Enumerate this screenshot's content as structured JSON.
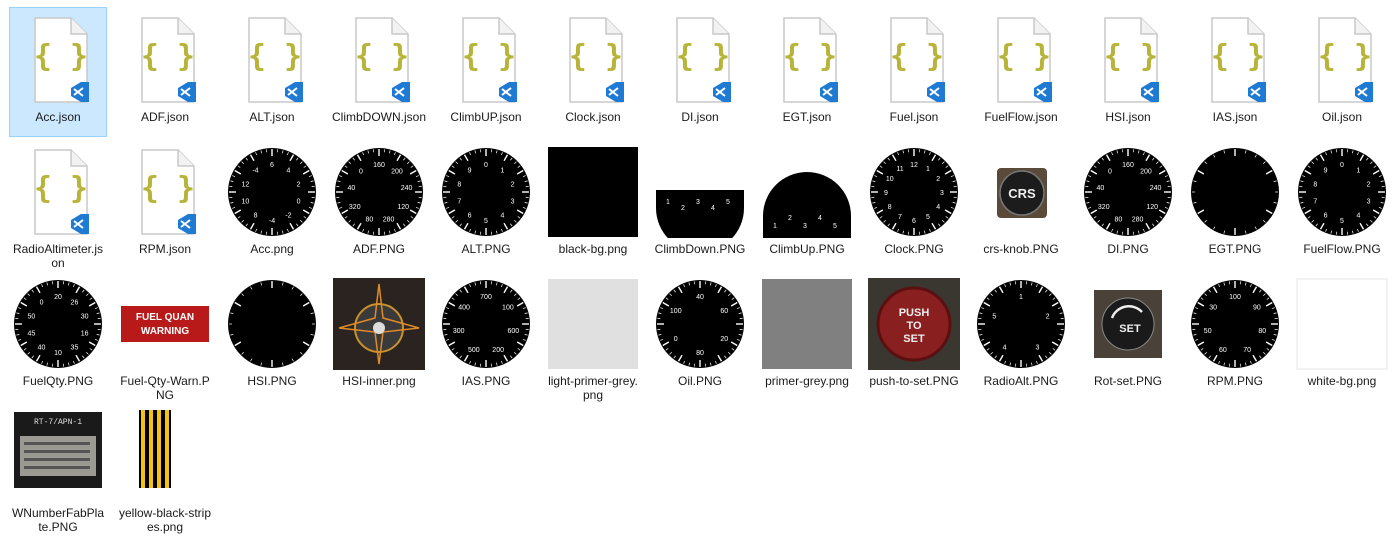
{
  "files": [
    {
      "name": "Acc.json",
      "kind": "json",
      "selected": true
    },
    {
      "name": "ADF.json",
      "kind": "json"
    },
    {
      "name": "ALT.json",
      "kind": "json"
    },
    {
      "name": "ClimbDOWN.json",
      "kind": "json"
    },
    {
      "name": "ClimbUP.json",
      "kind": "json"
    },
    {
      "name": "Clock.json",
      "kind": "json"
    },
    {
      "name": "DI.json",
      "kind": "json"
    },
    {
      "name": "EGT.json",
      "kind": "json"
    },
    {
      "name": "Fuel.json",
      "kind": "json"
    },
    {
      "name": "FuelFlow.json",
      "kind": "json"
    },
    {
      "name": "HSI.json",
      "kind": "json"
    },
    {
      "name": "IAS.json",
      "kind": "json"
    },
    {
      "name": "Oil.json",
      "kind": "json"
    },
    {
      "name": "RadioAltimeter.json",
      "kind": "json"
    },
    {
      "name": "RPM.json",
      "kind": "json"
    },
    {
      "name": "Acc.png",
      "kind": "dial",
      "labels": [
        "6",
        "4",
        "2",
        "0",
        "-2",
        "-4",
        "8",
        "10",
        "12",
        "-4"
      ]
    },
    {
      "name": "ADF.PNG",
      "kind": "dial",
      "labels": [
        "160",
        "200",
        "240",
        "120",
        "280",
        "80",
        "320",
        "40",
        "0"
      ]
    },
    {
      "name": "ALT.PNG",
      "kind": "dial",
      "labels": [
        "0",
        "1",
        "2",
        "3",
        "4",
        "5",
        "6",
        "7",
        "8",
        "9"
      ]
    },
    {
      "name": "black-bg.png",
      "kind": "square",
      "color": "#000000"
    },
    {
      "name": "ClimbDown.PNG",
      "kind": "half-down",
      "labels": [
        "1",
        "2",
        "3",
        "4",
        "5"
      ]
    },
    {
      "name": "ClimbUp.PNG",
      "kind": "half-up",
      "labels": [
        "1",
        "2",
        "3",
        "4",
        "5"
      ]
    },
    {
      "name": "Clock.PNG",
      "kind": "dial",
      "labels": [
        "12",
        "1",
        "2",
        "3",
        "4",
        "5",
        "6",
        "7",
        "8",
        "9",
        "10",
        "11"
      ]
    },
    {
      "name": "crs-knob.PNG",
      "kind": "knob",
      "text": "CRS"
    },
    {
      "name": "DI.PNG",
      "kind": "dial",
      "labels": [
        "160",
        "200",
        "240",
        "120",
        "280",
        "80",
        "320",
        "40",
        "0"
      ]
    },
    {
      "name": "EGT.PNG",
      "kind": "dial-sparse",
      "labels": []
    },
    {
      "name": "FuelFlow.PNG",
      "kind": "dial",
      "labels": [
        "0",
        "1",
        "2",
        "3",
        "4",
        "5",
        "6",
        "7",
        "8",
        "9"
      ]
    },
    {
      "name": "FuelQty.PNG",
      "kind": "dial",
      "labels": [
        "20",
        "26",
        "30",
        "16",
        "35",
        "10",
        "40",
        "45",
        "50",
        "0"
      ]
    },
    {
      "name": "Fuel-Qty-Warn.PNG",
      "kind": "warn",
      "text": "FUEL QUAN WARNING"
    },
    {
      "name": "HSI.PNG",
      "kind": "dial-sparse",
      "labels": []
    },
    {
      "name": "HSI-inner.png",
      "kind": "hsi"
    },
    {
      "name": "IAS.PNG",
      "kind": "dial",
      "labels": [
        "700",
        "100",
        "600",
        "200",
        "500",
        "300",
        "400"
      ]
    },
    {
      "name": "light-primer-grey.png",
      "kind": "square",
      "color": "#e0e0e0"
    },
    {
      "name": "Oil.PNG",
      "kind": "dial",
      "labels": [
        "40",
        "60",
        "20",
        "80",
        "0",
        "100"
      ]
    },
    {
      "name": "primer-grey.png",
      "kind": "square",
      "color": "#808080"
    },
    {
      "name": "push-to-set.PNG",
      "kind": "pushset",
      "text": "PUSH TO SET"
    },
    {
      "name": "RadioAlt.PNG",
      "kind": "dial",
      "labels": [
        "1",
        "2",
        "3",
        "4",
        "5"
      ]
    },
    {
      "name": "Rot-set.PNG",
      "kind": "rotset",
      "text": "SET"
    },
    {
      "name": "RPM.PNG",
      "kind": "dial",
      "labels": [
        "100",
        "90",
        "80",
        "70",
        "60",
        "50",
        "30"
      ]
    },
    {
      "name": "white-bg.png",
      "kind": "square",
      "color": "#ffffff"
    },
    {
      "name": "WNumberFabPlate.PNG",
      "kind": "plate",
      "text": "RT-7/APN-1"
    },
    {
      "name": "yellow-black-stripes.png",
      "kind": "stripes"
    }
  ],
  "colors": {
    "json_brace": "#b8b43a",
    "vscode": "#1e7ad2",
    "selection": "#cce8ff"
  }
}
